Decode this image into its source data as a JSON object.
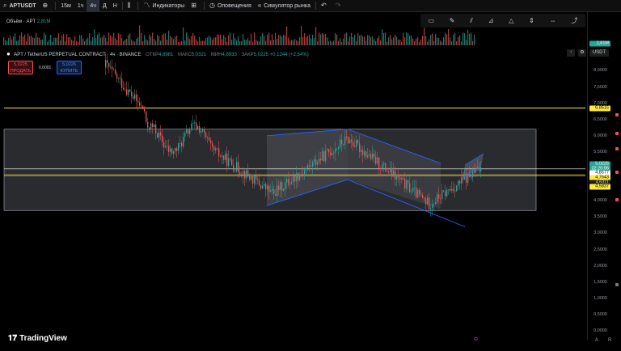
{
  "toolbar": {
    "symbol": "APTUSDT",
    "intervals": [
      {
        "label": "15м",
        "active": false
      },
      {
        "label": "1ч",
        "active": false
      },
      {
        "label": "4ч",
        "active": true
      },
      {
        "label": "Д",
        "active": false
      },
      {
        "label": "Н",
        "active": false
      }
    ],
    "indicators_label": "Индикаторы",
    "alerts_label": "Оповещения",
    "simulator_label": "Симулятор рынка"
  },
  "volume_legend": {
    "label": "Объём · APT",
    "value": "2,81M"
  },
  "legend": {
    "title": "APT / TetherUS PERPETUAL CONTRACT · 4ч · BINANCE",
    "open_label": "ОТКР",
    "open": "4,8981",
    "high_label": "МАКС",
    "high": "5,0321",
    "low_label": "МИН",
    "low": "4,8933",
    "close_label": "ЗАКР",
    "close": "5,0225",
    "change": "+0,1244 (+2,54%)"
  },
  "trade": {
    "sell_price": "5,0225",
    "sell_label": "ПРОДАТЬ",
    "spread": "0,0001",
    "buy_price": "5,0226",
    "buy_label": "КУПИТЬ"
  },
  "price_axis": {
    "currency": "USDT",
    "ticks": [
      "8,0000",
      "7,5000",
      "7,0000",
      "6,5000",
      "6,0000",
      "5,5000",
      "5,0000",
      "4,5000",
      "4,0000",
      "3,5000",
      "3,0000",
      "2,5000",
      "2,0000",
      "1,5000",
      "1,0000",
      "0,5000",
      "0,0000"
    ],
    "tags": [
      {
        "text": "2,81M",
        "price": null,
        "bg": "#26a69a",
        "fg": "#ffffff"
      },
      {
        "text": "6,8515",
        "price": 6.8515,
        "bg": "#ffeb3b",
        "fg": "#000000"
      },
      {
        "text": "5,0225",
        "price": 5.12,
        "bg": "#26a69a",
        "fg": "#ffffff"
      },
      {
        "text": "02:20:06",
        "price": 4.98,
        "bg": "#26a69a",
        "fg": "#ffffff"
      },
      {
        "text": "4,8577",
        "price": 4.8577,
        "bg": "#ffffff",
        "fg": "#000000"
      },
      {
        "text": "4,7643",
        "price": 4.7,
        "bg": "#ffeb3b",
        "fg": "#000000"
      },
      {
        "text": "4,6311",
        "price": 4.56,
        "bg": "#1e1e1e",
        "fg": "#d1d4dc"
      },
      {
        "text": "4,5837",
        "price": 4.42,
        "bg": "#ffeb3b",
        "fg": "#000000"
      }
    ]
  },
  "footer": {
    "brand": "TradingView",
    "auto": "A",
    "log": "R"
  },
  "colors": {
    "up": "#26a69a",
    "down": "#ef5350",
    "accent_line": "#ffeb3b",
    "channel": "#2962ff"
  }
}
